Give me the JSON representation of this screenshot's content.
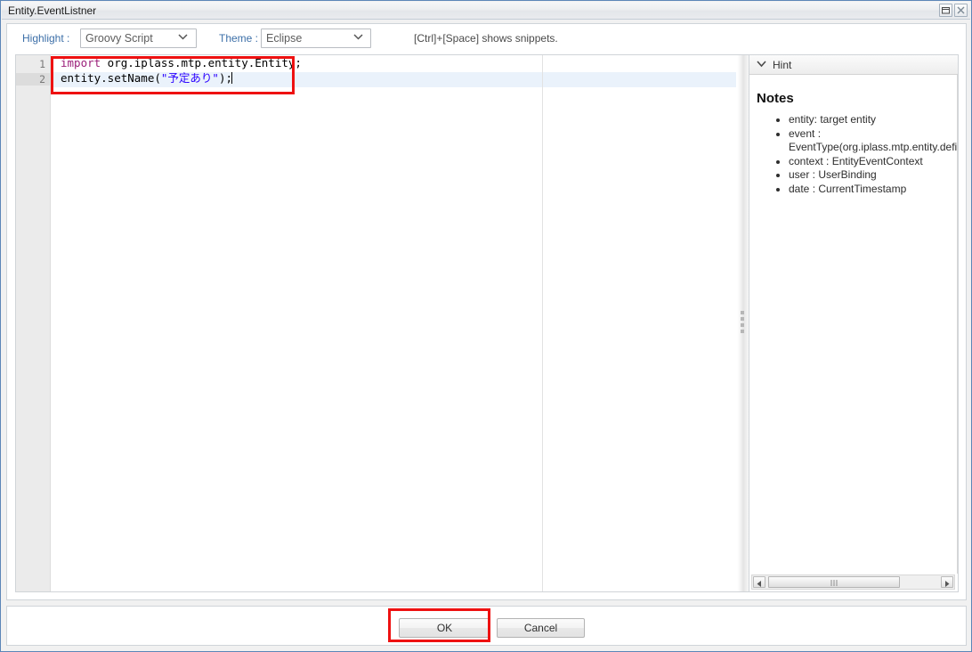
{
  "window": {
    "title": "Entity.EventListner",
    "controls": [
      {
        "name": "restore-button",
        "label": "Restore"
      },
      {
        "name": "close-button",
        "label": "Close"
      }
    ]
  },
  "toolbar": {
    "highlight_label": "Highlight :",
    "highlight_value": "Groovy Script",
    "theme_label": "Theme :",
    "theme_value": "Eclipse",
    "snippet_hint": "[Ctrl]+[Space] shows snippets."
  },
  "editor": {
    "line_numbers": [
      "1",
      "2"
    ],
    "lines": [
      {
        "number": "1",
        "tokens": [
          {
            "text": "import",
            "type": "keyword"
          },
          {
            "text": " org.iplass.mtp.entity.Entity;",
            "type": "plain"
          }
        ]
      },
      {
        "number": "2",
        "tokens": [
          {
            "text": "entity.setName(",
            "type": "plain"
          },
          {
            "text": "\"予定あり\"",
            "type": "string"
          },
          {
            "text": ");",
            "type": "plain"
          }
        ]
      }
    ],
    "plain_text": "import org.iplass.mtp.entity.Entity;\nentity.setName(\"予定あり\");",
    "active_line": 2,
    "colors": {
      "keyword": "#9b1f7a",
      "string": "#2a00ff",
      "plain": "#000000",
      "active_line_bg": "#eaf2fb",
      "gutter_bg": "#ebebeb"
    }
  },
  "hint": {
    "header_label": "Hint",
    "chevron_icon": "chevron-down-icon",
    "notes_title": "Notes",
    "notes": [
      "entity: target entity",
      "event : EventType(org.iplass.mtp.entity.definition.",
      "context : EntityEventContext",
      "user : UserBinding",
      "date : CurrentTimestamp"
    ],
    "scrollbar": {
      "left_arrow": "◀",
      "right_arrow": "▶",
      "grip": "|||"
    }
  },
  "footer": {
    "ok_label": "OK",
    "cancel_label": "Cancel"
  },
  "annotations": {
    "accent_color": "#ee1111",
    "code_box": "highlights the script code region",
    "ok_box": "highlights the OK button"
  }
}
